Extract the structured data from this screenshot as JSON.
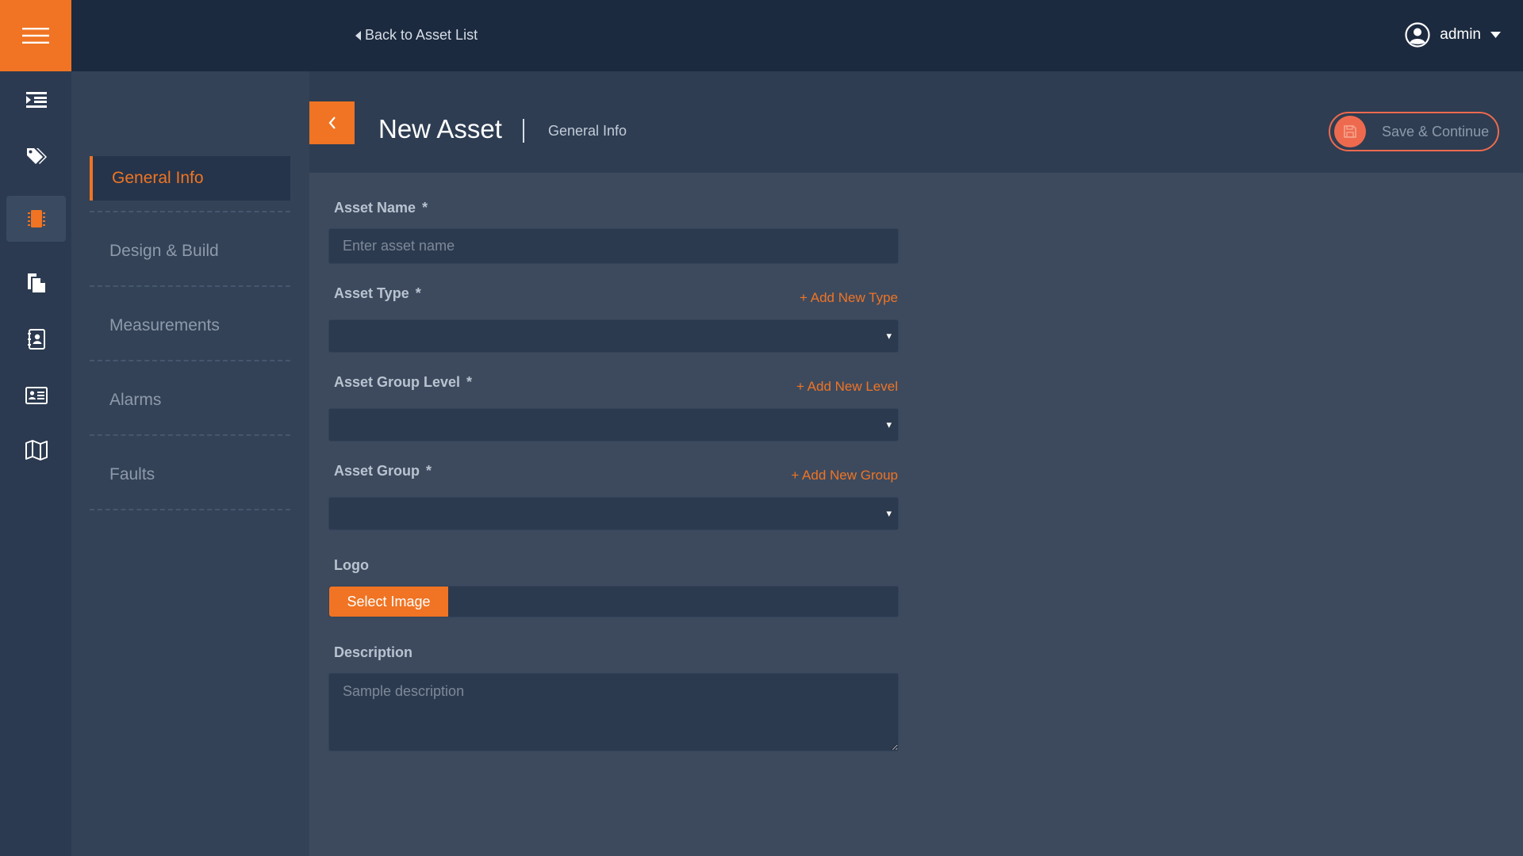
{
  "topbar": {
    "back_link": "Back to Asset List",
    "user": "admin"
  },
  "rail": {
    "items": [
      {
        "icon": "list-indent-icon"
      },
      {
        "icon": "tags-icon"
      },
      {
        "icon": "microchip-icon",
        "active": true
      },
      {
        "icon": "copy-documents-icon"
      },
      {
        "icon": "contact-book-icon"
      },
      {
        "icon": "id-card-icon"
      },
      {
        "icon": "map-icon"
      }
    ],
    "accent": "#f07423"
  },
  "steps": [
    {
      "label": "General Info",
      "active": true
    },
    {
      "label": "Design & Build"
    },
    {
      "label": "Measurements"
    },
    {
      "label": "Alarms"
    },
    {
      "label": "Faults"
    }
  ],
  "header": {
    "title": "New Asset",
    "subtitle": "General Info",
    "save_label": "Save & Continue"
  },
  "form": {
    "asset_name": {
      "label": "Asset Name",
      "required": "*",
      "placeholder": "Enter asset name",
      "value": ""
    },
    "asset_type": {
      "label": "Asset Type",
      "required": "*",
      "add_link": "+ Add New Type",
      "value": ""
    },
    "asset_group_level": {
      "label": "Asset Group Level",
      "required": "*",
      "add_link": "+ Add New Level",
      "value": ""
    },
    "asset_group": {
      "label": "Asset Group",
      "required": "*",
      "add_link": "+ Add New Group",
      "value": ""
    },
    "logo": {
      "label": "Logo",
      "button": "Select Image"
    },
    "description": {
      "label": "Description",
      "placeholder": "Sample description",
      "value": ""
    }
  },
  "select_caret": "▾"
}
